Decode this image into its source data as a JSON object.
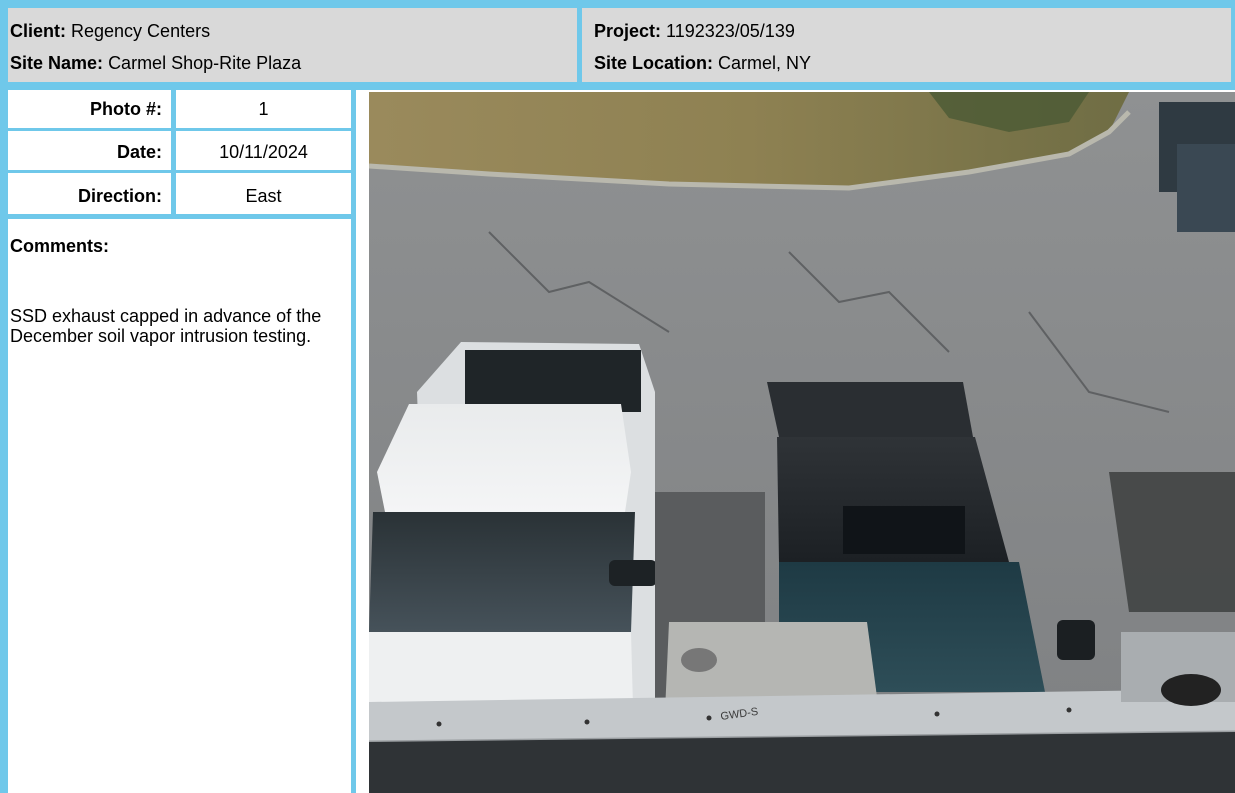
{
  "header": {
    "client_label": "Client:",
    "client_value": "Regency Centers",
    "site_name_label": "Site Name:",
    "site_name_value": "Carmel Shop-Rite Plaza",
    "project_label": "Project:",
    "project_value": "1192323/05/139",
    "site_location_label": "Site Location:",
    "site_location_value": "Carmel, NY"
  },
  "info": {
    "photo_label": "Photo #:",
    "photo_value": "1",
    "date_label": "Date:",
    "date_value": "10/11/2024",
    "direction_label": "Direction:",
    "direction_value": "East"
  },
  "comments": {
    "title": "Comments:",
    "body": "SSD exhaust capped in advance of the December soil vapor intrusion testing."
  },
  "photo": {
    "handwriting": "GWD-S"
  },
  "colors": {
    "border": "#6fc8ea",
    "header_bg": "#d9d9d9"
  }
}
